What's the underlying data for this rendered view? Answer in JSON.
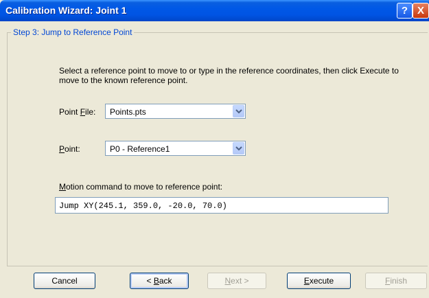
{
  "window": {
    "title": "Calibration Wizard: Joint 1",
    "help_glyph": "?",
    "close_glyph": "X"
  },
  "step": {
    "title": "Step 3: Jump to Reference Point"
  },
  "intro": "Select a reference point to move to or type in the reference coordinates, then click Execute to move to the known reference point.",
  "point_file": {
    "label_prefix": "Point ",
    "label_accel": "F",
    "label_rest": "ile:",
    "value": "Points.pts"
  },
  "point": {
    "label_accel": "P",
    "label_rest": "oint:",
    "value": "P0 - Reference1"
  },
  "motion": {
    "label_accel": "M",
    "label_rest": "otion command to move to reference point:",
    "value": "Jump XY(245.1, 359.0, -20.0, 70.0)"
  },
  "buttons": {
    "cancel": "Cancel",
    "back_prefix": "< ",
    "back_accel": "B",
    "back_rest": "ack",
    "next_accel": "N",
    "next_rest": "ext >",
    "execute_accel": "E",
    "execute_rest": "xecute",
    "finish_accel": "F",
    "finish_rest": "inish"
  },
  "colors": {
    "titlebar": "#0054e3",
    "group_title": "#0046d5",
    "dialog_bg": "#ece9d8"
  }
}
